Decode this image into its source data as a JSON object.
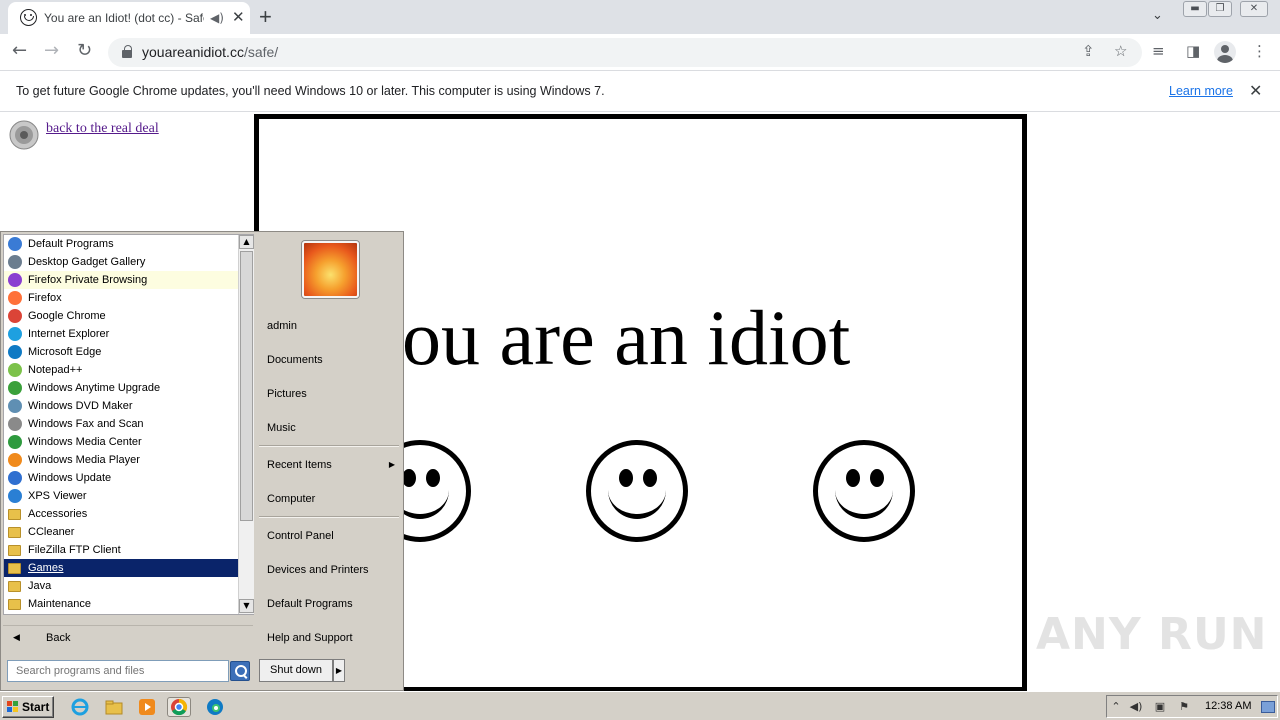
{
  "browser": {
    "tab": {
      "title": "You are an Idiot! (dot cc) - Safe",
      "close": "✕"
    },
    "new_tab": "+",
    "url": {
      "host": "youareanidiot.cc",
      "path": "/safe/"
    },
    "window_buttons": [
      "minimize",
      "restore",
      "close"
    ]
  },
  "infobar": {
    "message": "To get future Google Chrome updates, you'll need Windows 10 or later. This computer is using Windows 7.",
    "link": "Learn more",
    "close": "✕"
  },
  "page": {
    "back_link": "back to the real deal",
    "headline": "you are an idiot",
    "smiley_count": 3
  },
  "watermark": "ANY RUN",
  "start_menu": {
    "programs": [
      {
        "label": "Default Programs",
        "icon": "default-programs-icon",
        "color": "#3a7bd5"
      },
      {
        "label": "Desktop Gadget Gallery",
        "icon": "gadget-icon",
        "color": "#6b7d8f"
      },
      {
        "label": "Firefox Private Browsing",
        "icon": "firefox-private-icon",
        "color": "#8a3fd1",
        "highlight": true
      },
      {
        "label": "Firefox",
        "icon": "firefox-icon",
        "color": "#ff7139"
      },
      {
        "label": "Google Chrome",
        "icon": "chrome-icon",
        "color": "#db4437"
      },
      {
        "label": "Internet Explorer",
        "icon": "ie-icon",
        "color": "#1ea0e0"
      },
      {
        "label": "Microsoft Edge",
        "icon": "edge-icon",
        "color": "#0f7ac4"
      },
      {
        "label": "Notepad++",
        "icon": "notepadpp-icon",
        "color": "#7cc24a"
      },
      {
        "label": "Windows Anytime Upgrade",
        "icon": "windows-upgrade-icon",
        "color": "#3aa03a"
      },
      {
        "label": "Windows DVD Maker",
        "icon": "dvd-maker-icon",
        "color": "#5f8fb3"
      },
      {
        "label": "Windows Fax and Scan",
        "icon": "fax-icon",
        "color": "#8a8a8a"
      },
      {
        "label": "Windows Media Center",
        "icon": "media-center-icon",
        "color": "#2e9a3e"
      },
      {
        "label": "Windows Media Player",
        "icon": "media-player-icon",
        "color": "#f08a1c"
      },
      {
        "label": "Windows Update",
        "icon": "windows-update-icon",
        "color": "#2f6fd0"
      },
      {
        "label": "XPS Viewer",
        "icon": "xps-viewer-icon",
        "color": "#2a7fd4"
      },
      {
        "label": "Accessories",
        "icon": "folder-icon",
        "folder": true
      },
      {
        "label": "CCleaner",
        "icon": "folder-icon",
        "folder": true
      },
      {
        "label": "FileZilla FTP Client",
        "icon": "folder-icon",
        "folder": true
      },
      {
        "label": "Games",
        "icon": "folder-icon",
        "folder": true,
        "selected": true
      },
      {
        "label": "Java",
        "icon": "folder-icon",
        "folder": true
      },
      {
        "label": "Maintenance",
        "icon": "folder-icon",
        "folder": true
      }
    ],
    "back": "Back",
    "search_placeholder": "Search programs and files",
    "right_pane": {
      "user": "admin",
      "items": [
        "Documents",
        "Pictures",
        "Music"
      ],
      "recent": "Recent Items",
      "computer": "Computer",
      "system": [
        "Control Panel",
        "Devices and Printers",
        "Default Programs",
        "Help and Support"
      ]
    },
    "shutdown": "Shut down"
  },
  "taskbar": {
    "start": "Start",
    "apps": [
      "ie-icon",
      "explorer-icon",
      "media-player-icon",
      "chrome-icon",
      "edge-icon"
    ],
    "clock": "12:38 AM"
  }
}
